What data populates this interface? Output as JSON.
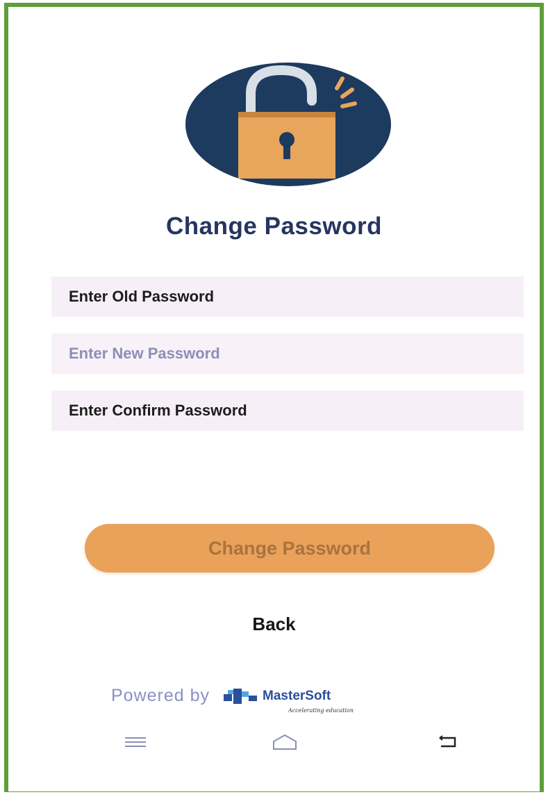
{
  "screen": {
    "title": "Change Password"
  },
  "form": {
    "old_password_placeholder": "Enter Old Password",
    "new_password_placeholder": "Enter New Password",
    "confirm_password_placeholder": "Enter Confirm Password"
  },
  "actions": {
    "submit_label": "Change Password",
    "back_label": "Back"
  },
  "footer": {
    "powered_by": "Powered by",
    "brand_name": "MasterSoft",
    "brand_tagline": "Accelerating education"
  },
  "icons": {
    "logo": "unlocked-padlock-icon",
    "nav_menu": "menu-icon",
    "nav_home": "home-icon",
    "nav_back": "back-icon"
  },
  "colors": {
    "frame_border": "#5f9e3a",
    "title": "#263560",
    "button": "#eaa15a",
    "button_text": "#a8743e",
    "field_bg": "#f7eff7",
    "logo_bg": "#1d3a5f",
    "padlock": "#e8a55c"
  }
}
